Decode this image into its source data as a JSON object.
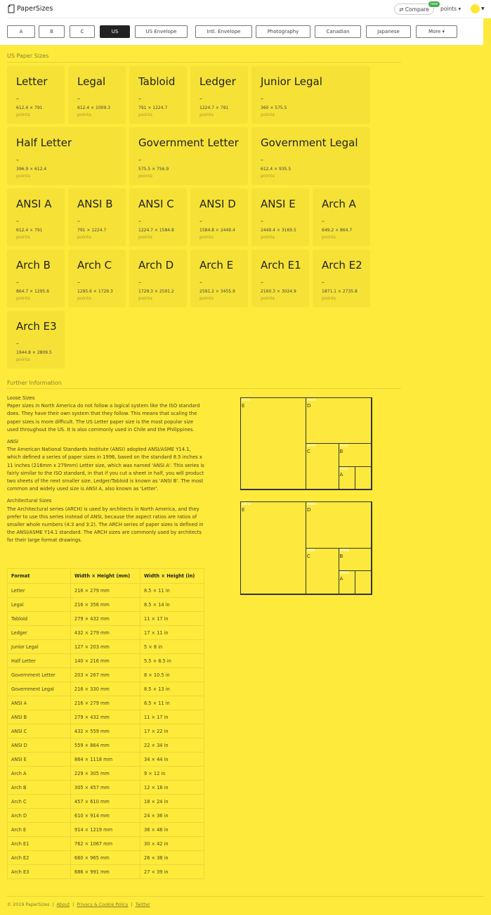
{
  "header": {
    "brand": "PaperSizes",
    "compare_label": "⇄ Compare",
    "new_badge": "new",
    "units_label": "points ▾",
    "avatar_color": "#fde730"
  },
  "nav": {
    "tabs": [
      {
        "label": "A"
      },
      {
        "label": "B"
      },
      {
        "label": "C"
      },
      {
        "label": "US",
        "active": true
      },
      {
        "label": "US Envelope"
      },
      {
        "label": "Intl. Envelope"
      },
      {
        "label": "Photography"
      },
      {
        "label": "Canadian"
      },
      {
        "label": "Japanese"
      },
      {
        "label": "More ▾"
      }
    ]
  },
  "sizes_section": {
    "title": "US Paper Sizes",
    "unit": "points",
    "cards": [
      {
        "name": "Letter",
        "dims": "612.4 × 791"
      },
      {
        "name": "Legal",
        "dims": "612.4 × 1009.3"
      },
      {
        "name": "Tabloid",
        "dims": "791 × 1224.7"
      },
      {
        "name": "Ledger",
        "dims": "1224.7 × 791"
      },
      {
        "name": "Junior Legal",
        "dims": "360 × 575.5"
      },
      {
        "name": "Half Letter",
        "dims": "396.9 × 612.4"
      },
      {
        "name": "Government Letter",
        "dims": "575.5 × 756.9"
      },
      {
        "name": "Government Legal",
        "dims": "612.4 × 935.5"
      },
      {
        "name": "ANSI A",
        "dims": "612.4 × 791"
      },
      {
        "name": "ANSI B",
        "dims": "791 × 1224.7"
      },
      {
        "name": "ANSI C",
        "dims": "1224.7 × 1584.8"
      },
      {
        "name": "ANSI D",
        "dims": "1584.8 × 2449.4"
      },
      {
        "name": "ANSI E",
        "dims": "2449.4 × 3169.5"
      },
      {
        "name": "Arch A",
        "dims": "649.2 × 864.7"
      },
      {
        "name": "Arch B",
        "dims": "864.7 × 1295.6"
      },
      {
        "name": "Arch C",
        "dims": "1295.6 × 1729.3"
      },
      {
        "name": "Arch D",
        "dims": "1729.3 × 2591.2"
      },
      {
        "name": "Arch E",
        "dims": "2591.2 × 3455.9"
      },
      {
        "name": "Arch E1",
        "dims": "2160.3 × 3024.9"
      },
      {
        "name": "Arch E2",
        "dims": "1871.1 × 2735.8"
      },
      {
        "name": "Arch E3",
        "dims": "1944.8 × 2809.5"
      }
    ]
  },
  "info_section": {
    "title": "Further Information",
    "blocks": [
      {
        "heading": "Loose Sizes",
        "text": "Paper sizes in North America do not follow a logical system like the ISO standard does. They have their own system that they follow. This means that scaling the paper sizes is more difficult. The US Letter paper size is the most popular size used throughout the US. It is also commonly used in Chile and the Philippines."
      },
      {
        "heading": "ANSI",
        "text": "The American National Standards Institute (ANSI) adopted ANSI/ASME Y14.1, which defined a series of paper sizes in 1996, based on the standard 8.5 inches x 11 inches (216mm x 279mm) Letter size, which was named 'ANSI A'. This series is fairly similar to the ISO standard, in that if you cut a sheet in half, you will product two sheets of the next smaller size. Ledger/Tabloid is known as 'ANSI B'. The most common and widely used size is ANSI A, also known as 'Letter'."
      },
      {
        "heading": "Architectural Sizes",
        "text": "The Architectural series (ARCH) is used by architects in North America, and they prefer to use this series instead of ANSI, because the aspect ratios are ratios of smaller whole numbers (4:3 and 3:2). The ARCH series of paper sizes is defined in the ANSI/ASME Y14.1 standard. The ARCH sizes are commonly used by architects for their large format drawings."
      }
    ]
  },
  "diagrams": {
    "arch": {
      "prefix": "Arch",
      "labels": [
        "E",
        "D",
        "C",
        "B",
        "A"
      ]
    },
    "ansi": {
      "prefix": "ANSI",
      "labels": [
        "E",
        "D",
        "C",
        "B",
        "A"
      ],
      "c_prefix": "ANS"
    }
  },
  "table": {
    "headers": [
      "Format",
      "Width × Height (mm)",
      "Width × Height (in)"
    ],
    "rows": [
      [
        "Letter",
        "216 × 279 mm",
        "8.5 × 11 in"
      ],
      [
        "Legal",
        "216 × 356 mm",
        "8.5 × 14 in"
      ],
      [
        "Tabloid",
        "279 × 432 mm",
        "11 × 17 in"
      ],
      [
        "Ledger",
        "432 × 279 mm",
        "17 × 11 in"
      ],
      [
        "Junior Legal",
        "127 × 203 mm",
        "5 × 8 in"
      ],
      [
        "Half Letter",
        "140 × 216 mm",
        "5.5 × 8.5 in"
      ],
      [
        "Government Letter",
        "203 × 267 mm",
        "8 × 10.5 in"
      ],
      [
        "Government Legal",
        "216 × 330 mm",
        "8.5 × 13 in"
      ],
      [
        "ANSI A",
        "216 × 279 mm",
        "8.5 × 11 in"
      ],
      [
        "ANSI B",
        "279 × 432 mm",
        "11 × 17 in"
      ],
      [
        "ANSI C",
        "432 × 559 mm",
        "17 × 22 in"
      ],
      [
        "ANSI D",
        "559 × 864 mm",
        "22 × 34 in"
      ],
      [
        "ANSI E",
        "864 × 1118 mm",
        "34 × 44 in"
      ],
      [
        "Arch A",
        "229 × 305 mm",
        "9 × 12 in"
      ],
      [
        "Arch B",
        "305 × 457 mm",
        "12 × 18 in"
      ],
      [
        "Arch C",
        "457 × 610 mm",
        "18 × 24 in"
      ],
      [
        "Arch D",
        "610 × 914 mm",
        "24 × 36 in"
      ],
      [
        "Arch E",
        "914 × 1219 mm",
        "36 × 48 in"
      ],
      [
        "Arch E1",
        "762 × 1067 mm",
        "30 × 42 in"
      ],
      [
        "Arch E2",
        "660 × 965 mm",
        "26 × 38 in"
      ],
      [
        "Arch E3",
        "686 × 991 mm",
        "27 × 39 in"
      ]
    ]
  },
  "footer": {
    "copyright": "© 2019 PaperSizes",
    "links": [
      "About",
      "Privacy & Cookie Policy",
      "Twitter"
    ],
    "separator": "|"
  }
}
